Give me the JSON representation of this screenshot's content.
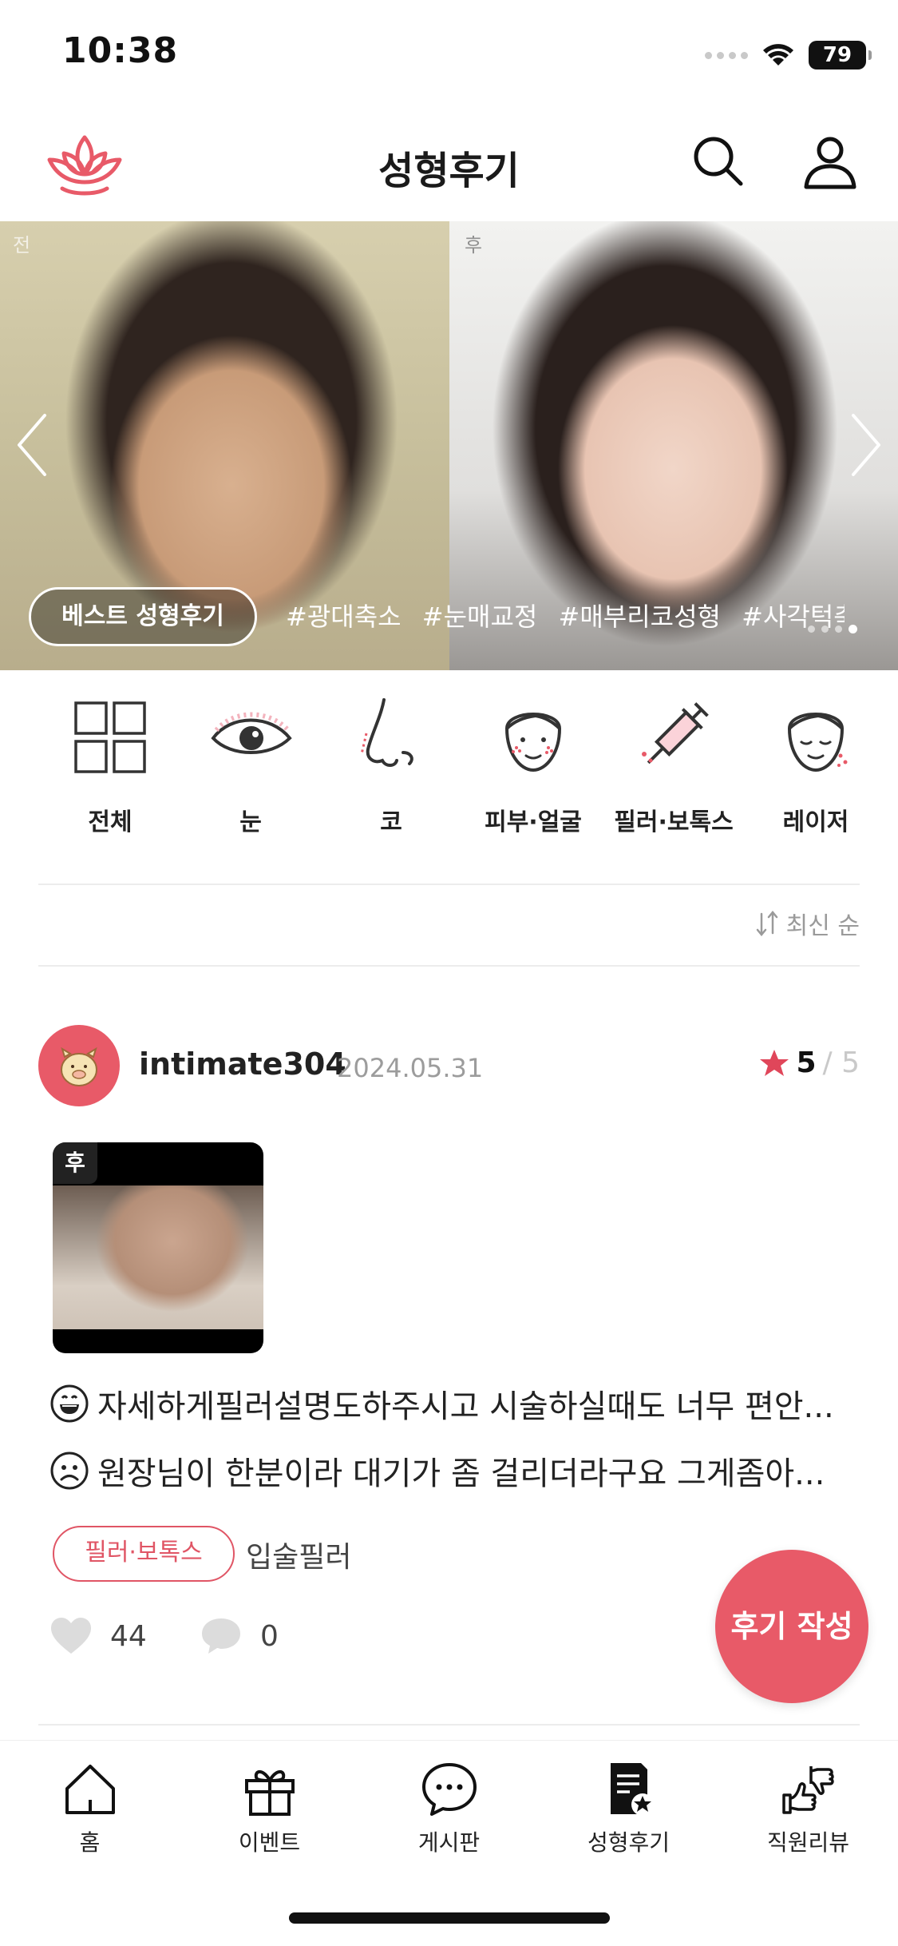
{
  "status_bar": {
    "time": "10:38",
    "battery": "79"
  },
  "header": {
    "title": "성형후기"
  },
  "banner": {
    "before_label": "전",
    "after_label": "후",
    "badge": "베스트 성형후기",
    "tags": [
      "#광대축소",
      "#눈매교정",
      "#매부리코성형",
      "#사각턱축"
    ]
  },
  "categories": [
    {
      "label": "전체",
      "icon": "grid-icon"
    },
    {
      "label": "눈",
      "icon": "eye-icon"
    },
    {
      "label": "코",
      "icon": "nose-icon"
    },
    {
      "label": "피부·얼굴",
      "icon": "face-skin-icon"
    },
    {
      "label": "필러·보톡스",
      "icon": "syringe-icon"
    },
    {
      "label": "레이저",
      "icon": "laser-face-icon"
    }
  ],
  "sort": {
    "label": "최신 순"
  },
  "review": {
    "username": "intimate304",
    "date": "2024.05.31",
    "rating": "5",
    "rating_max": "/ 5",
    "thumb_badge": "후",
    "positive": "자세하게필러설명도하주시고 시술하실때도 너무 편안...",
    "negative": "원장님이 한분이라 대기가 좀 걸리더라구요 그게좀아...",
    "category_tag": "필러·보톡스",
    "procedure": "입술필러",
    "likes": "44",
    "comments": "0"
  },
  "fab": {
    "label": "후기 작성"
  },
  "bottom_nav": [
    {
      "label": "홈",
      "icon": "home-icon"
    },
    {
      "label": "이벤트",
      "icon": "gift-icon"
    },
    {
      "label": "게시판",
      "icon": "chat-bubble-icon"
    },
    {
      "label": "성형후기",
      "icon": "review-doc-icon"
    },
    {
      "label": "직원리뷰",
      "icon": "thumbs-icon"
    }
  ],
  "colors": {
    "accent": "#e85a68",
    "tag_border": "#e05565",
    "muted": "#9c9c9c"
  }
}
